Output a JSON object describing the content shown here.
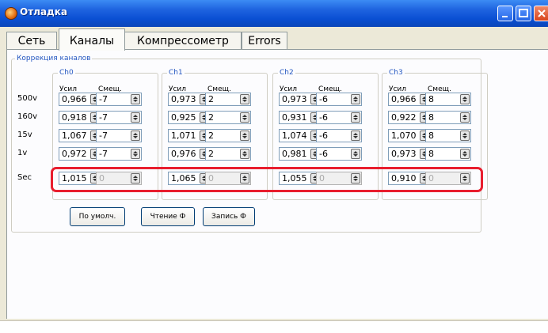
{
  "window": {
    "title": "Отладка"
  },
  "tabs": [
    {
      "label": "Сеть"
    },
    {
      "label": "Каналы"
    },
    {
      "label": "Компрессометр"
    },
    {
      "label": "Errors"
    }
  ],
  "group": {
    "title": "Коррекция каналов"
  },
  "channels": [
    {
      "name": "Ch0",
      "gain_label": "Усил",
      "offset_label": "Смещ."
    },
    {
      "name": "Ch1",
      "gain_label": "Усил",
      "offset_label": "Смещ."
    },
    {
      "name": "Ch2",
      "gain_label": "Усил",
      "offset_label": "Смещ."
    },
    {
      "name": "Ch3",
      "gain_label": "Усил",
      "offset_label": "Смещ."
    }
  ],
  "rows": [
    {
      "label": "500v",
      "values": [
        [
          "0,966",
          "-7"
        ],
        [
          "0,973",
          "2"
        ],
        [
          "0,973",
          "-6"
        ],
        [
          "0,966",
          "8"
        ]
      ]
    },
    {
      "label": "160v",
      "values": [
        [
          "0,918",
          "-7"
        ],
        [
          "0,925",
          "2"
        ],
        [
          "0,931",
          "-6"
        ],
        [
          "0,922",
          "8"
        ]
      ]
    },
    {
      "label": "15v",
      "values": [
        [
          "1,067",
          "-7"
        ],
        [
          "1,071",
          "2"
        ],
        [
          "1,074",
          "-6"
        ],
        [
          "1,070",
          "8"
        ]
      ]
    },
    {
      "label": "1v",
      "values": [
        [
          "0,972",
          "-7"
        ],
        [
          "0,976",
          "2"
        ],
        [
          "0,981",
          "-6"
        ],
        [
          "0,973",
          "8"
        ]
      ]
    },
    {
      "label": "Sec",
      "values": [
        [
          "1,015",
          "0"
        ],
        [
          "1,065",
          "0"
        ],
        [
          "1,055",
          "0"
        ],
        [
          "0,910",
          "0"
        ]
      ]
    }
  ],
  "buttons": [
    {
      "label": "По умолч."
    },
    {
      "label": "Чтение Ф"
    },
    {
      "label": "Запись Ф"
    }
  ],
  "colors": {
    "titlebar": "#0a4fd3",
    "highlight": "#e81e2e",
    "group_label": "#2457c0"
  }
}
